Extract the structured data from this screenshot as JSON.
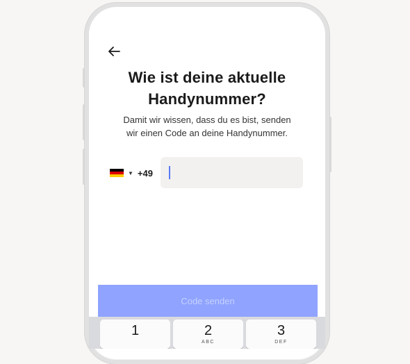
{
  "header": {
    "title_line1": "Wie ist deine aktuelle",
    "title_line2": "Handynummer?",
    "subtitle_line1": "Damit wir wissen, dass du es bist, senden",
    "subtitle_line2": "wir einen Code an deine Handynummer."
  },
  "phone": {
    "country_flag": "germany-flag-icon",
    "dial_code": "+49",
    "value": "",
    "placeholder": ""
  },
  "submit": {
    "label": "Code senden"
  },
  "keypad": {
    "keys": [
      {
        "digit": "1",
        "letters": ""
      },
      {
        "digit": "2",
        "letters": "ABC"
      },
      {
        "digit": "3",
        "letters": "DEF"
      }
    ]
  },
  "colors": {
    "primary": "#8fa3ff",
    "input_bg": "#f2f1ef",
    "text": "#1a1a1a"
  }
}
